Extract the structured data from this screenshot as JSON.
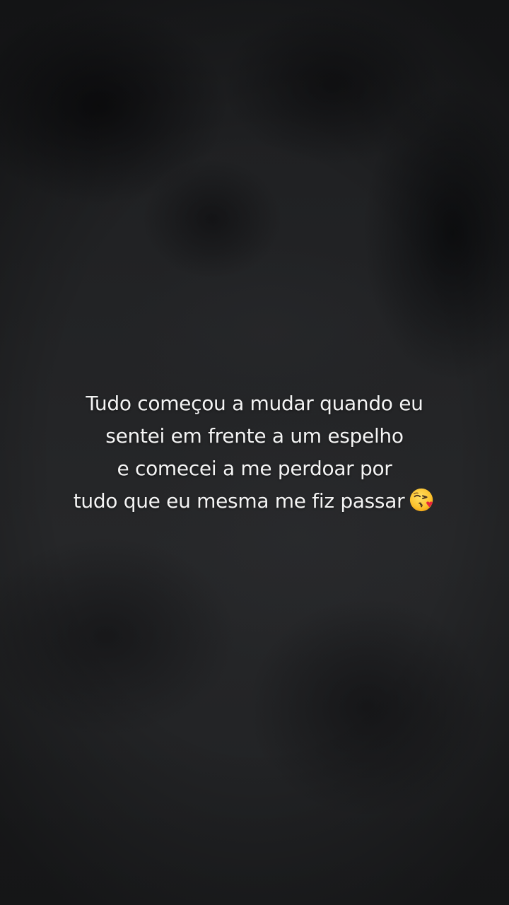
{
  "story": {
    "caption_lines": [
      "Tudo começou a mudar quando eu",
      "sentei em frente a um espelho",
      "e comecei a me perdoar por",
      "tudo que eu mesma me fiz passar"
    ],
    "emoji": "face-blowing-a-kiss-icon"
  },
  "colors": {
    "background": "#1c1d1f",
    "text": "#f4f4f4"
  }
}
